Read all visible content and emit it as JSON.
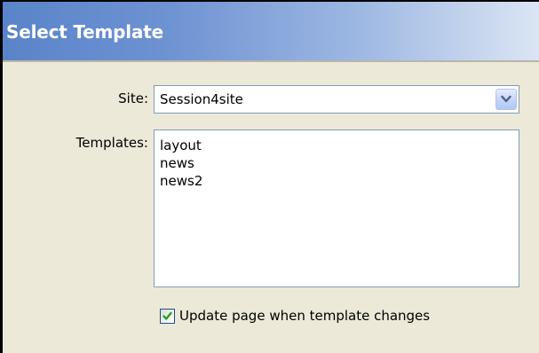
{
  "dialog": {
    "title": "Select Template"
  },
  "site": {
    "label": "Site:",
    "selected_value": "Session4site"
  },
  "templates": {
    "label": "Templates:",
    "items": [
      "layout",
      "news",
      "news2"
    ]
  },
  "update_option": {
    "label": "Update page when template changes",
    "checked": true
  },
  "icons": {
    "dropdown_arrow": "chevron-down-icon",
    "checkbox_mark": "checkmark-icon"
  },
  "colors": {
    "title_gradient_start": "#5a84c9",
    "title_gradient_end": "#dbe5f4",
    "dialog_background": "#ece9d8",
    "field_border": "#7f9db9",
    "checkmark": "#21a121"
  }
}
